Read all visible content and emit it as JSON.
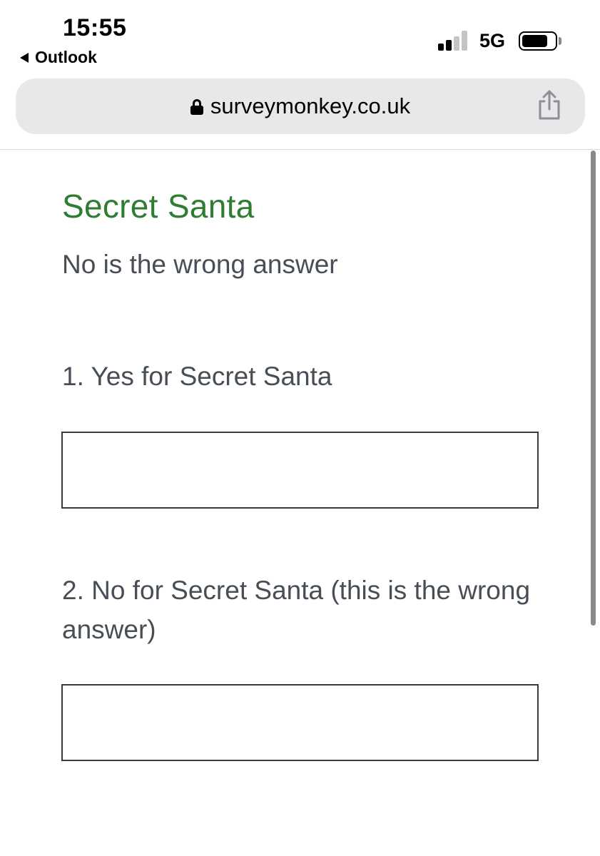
{
  "status_bar": {
    "time": "15:55",
    "back_app": "Outlook",
    "network": "5G",
    "signal_bars_active": 2,
    "signal_bars_total": 4,
    "battery_level": 0.8
  },
  "browser": {
    "url": "surveymonkey.co.uk"
  },
  "survey": {
    "title": "Secret Santa",
    "description": "No is the wrong answer",
    "questions": [
      {
        "label": "1. Yes for Secret Santa",
        "answer": ""
      },
      {
        "label": "2. No for Secret Santa (this is the wrong answer)",
        "answer": ""
      }
    ]
  },
  "colors": {
    "title_green": "#2e7d32",
    "text_gray": "#474e55",
    "address_bar_bg": "#e7e8ea"
  }
}
